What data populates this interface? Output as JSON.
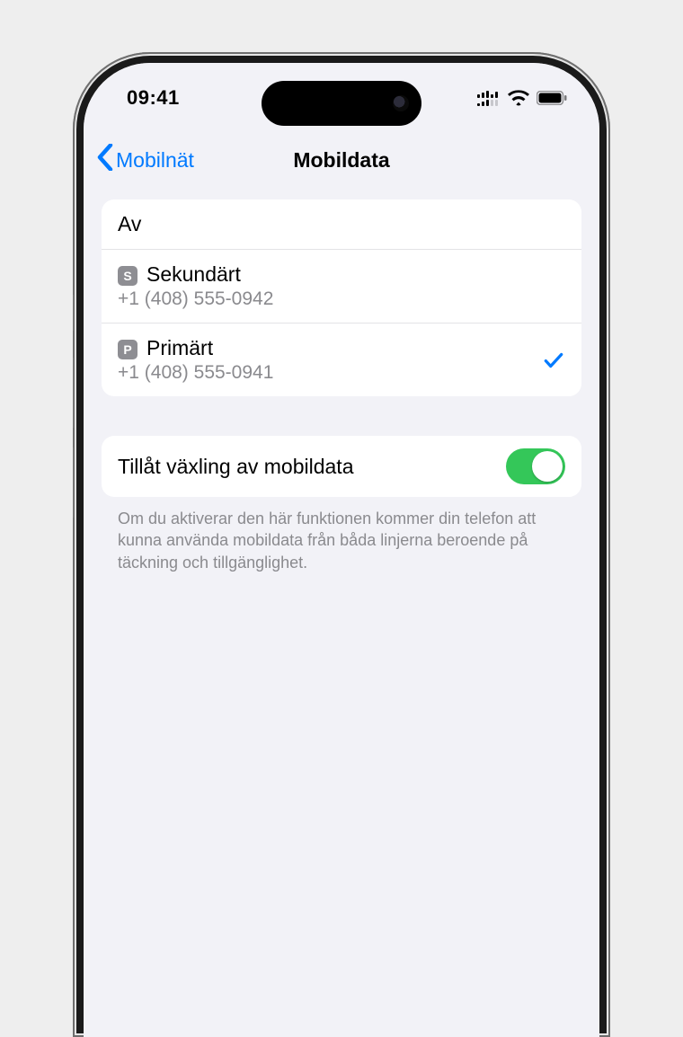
{
  "status": {
    "time": "09:41"
  },
  "nav": {
    "back_label": "Mobilnät",
    "title": "Mobildata"
  },
  "lines_group": {
    "off_label": "Av",
    "items": [
      {
        "badge_letter": "S",
        "name": "Sekundärt",
        "number": "+1 (408) 555-0942",
        "selected": false
      },
      {
        "badge_letter": "P",
        "name": "Primärt",
        "number": "+1 (408) 555-0941",
        "selected": true
      }
    ]
  },
  "switching": {
    "label": "Tillåt växling av mobildata",
    "enabled": true,
    "footer": "Om du aktiverar den här funktionen kommer din telefon att kunna använda mobildata från båda linjerna beroende på täckning och tillgänglighet."
  },
  "colors": {
    "accent": "#007aff",
    "switch_on": "#34c759",
    "secondary_text": "#8a8a8e"
  }
}
